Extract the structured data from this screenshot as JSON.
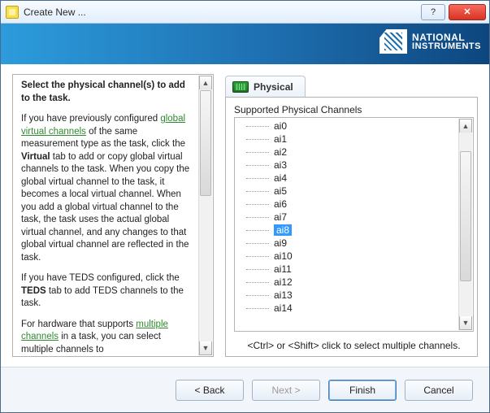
{
  "window": {
    "title": "Create New ..."
  },
  "brand": {
    "line1": "NATIONAL",
    "line2": "INSTRUMENTS"
  },
  "help": {
    "heading": "Select the physical channel(s) to add to the task.",
    "para1a": "If you have previously configured ",
    "link_gvc": "global virtual channels",
    "para1b": " of the same measurement type as the task, click the ",
    "virtual_bold": "Virtual",
    "para1c": " tab to add or copy global virtual channels to the task. When you copy the global virtual channel to the task, it becomes a local virtual channel. When you add a global virtual channel to the task, the task uses the actual global virtual channel, and any changes to that global virtual channel are reflected in the task.",
    "para2a": "If you have TEDS configured, click the ",
    "teds_bold": "TEDS",
    "para2b": " tab to add TEDS channels to the task.",
    "para3a": "For hardware that supports ",
    "link_mc": "multiple channels",
    "para3b": " in a task, you can select multiple channels to"
  },
  "tab": {
    "label": "Physical"
  },
  "list": {
    "label": "Supported Physical Channels"
  },
  "channels": [
    {
      "name": "ai0"
    },
    {
      "name": "ai1"
    },
    {
      "name": "ai2"
    },
    {
      "name": "ai3"
    },
    {
      "name": "ai4"
    },
    {
      "name": "ai5"
    },
    {
      "name": "ai6"
    },
    {
      "name": "ai7"
    },
    {
      "name": "ai8",
      "selected": true
    },
    {
      "name": "ai9"
    },
    {
      "name": "ai10"
    },
    {
      "name": "ai11"
    },
    {
      "name": "ai12"
    },
    {
      "name": "ai13"
    },
    {
      "name": "ai14"
    }
  ],
  "hint": "<Ctrl> or <Shift> click to select multiple channels.",
  "buttons": {
    "back": "< Back",
    "next": "Next >",
    "finish": "Finish",
    "cancel": "Cancel"
  }
}
